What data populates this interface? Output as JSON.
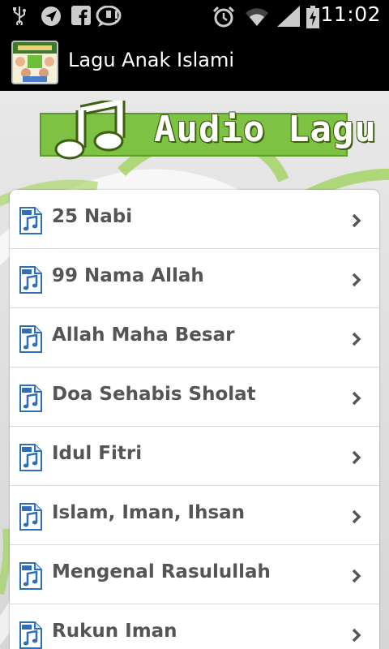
{
  "status_bar": {
    "time": "11:02",
    "icons": [
      "usb-icon",
      "navigation-icon",
      "facebook-icon",
      "speech-bubble-icon",
      "alarm-icon",
      "wifi-icon",
      "signal-icon",
      "battery-charging-icon"
    ]
  },
  "action_bar": {
    "title": "Lagu Anak Islami",
    "app_icon": "app-logo-icon"
  },
  "banner": {
    "text": "Audio Lagu",
    "icon": "music-note-icon",
    "color": "#7dc242"
  },
  "songs": [
    {
      "label": "25 Nabi"
    },
    {
      "label": "99 Nama Allah"
    },
    {
      "label": "Allah Maha Besar"
    },
    {
      "label": "Doa Sehabis Sholat"
    },
    {
      "label": "Idul Fitri"
    },
    {
      "label": "Islam, Iman, Ihsan"
    },
    {
      "label": "Mengenal Rasulullah"
    },
    {
      "label": "Rukun Iman"
    }
  ],
  "item_icon": "audio-file-icon",
  "chevron_icon": "chevron-right-icon"
}
